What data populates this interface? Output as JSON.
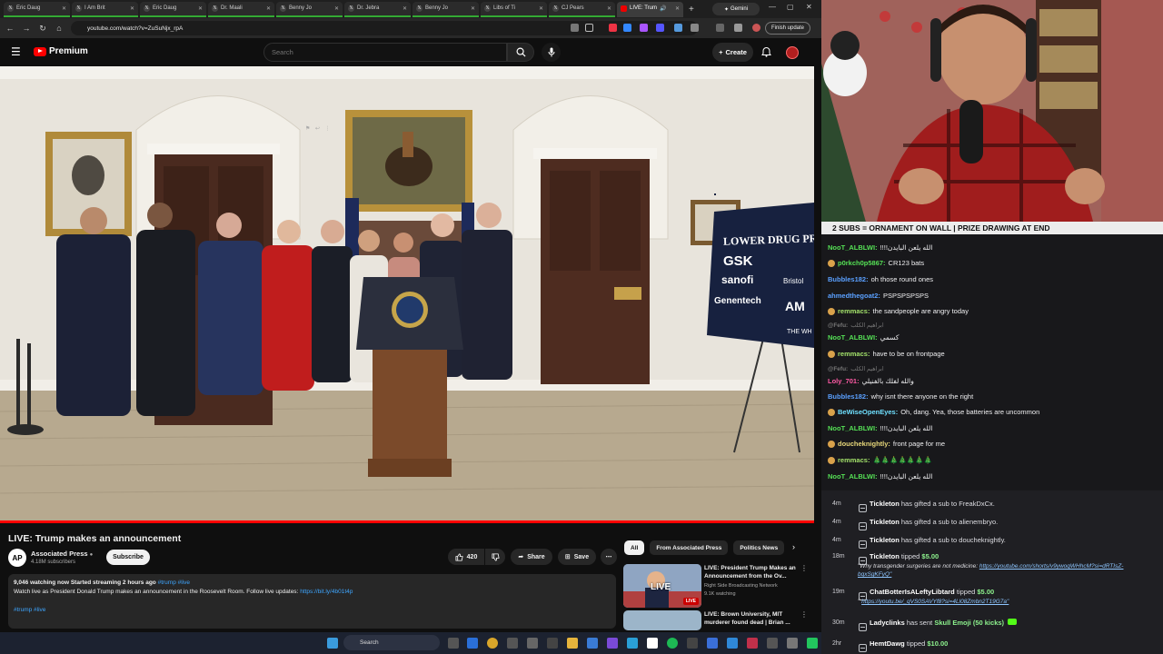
{
  "browser": {
    "tabs": [
      {
        "label": "Eric Daug",
        "icon": "x-icon"
      },
      {
        "label": "I Am Brit",
        "icon": "x-icon"
      },
      {
        "label": "Eric Daug",
        "icon": "x-icon"
      },
      {
        "label": "Dr. Maali",
        "icon": "x-icon"
      },
      {
        "label": "Benny Jo",
        "icon": "x-icon"
      },
      {
        "label": "Dr. Jebra",
        "icon": "x-icon"
      },
      {
        "label": "Benny Jo",
        "icon": "x-icon"
      },
      {
        "label": "Libs of Ti",
        "icon": "x-icon"
      },
      {
        "label": "CJ Pears",
        "icon": "x-icon"
      },
      {
        "label": "LIVE: Trum",
        "icon": "youtube-icon",
        "active": true
      }
    ],
    "gemini_label": "Gemini",
    "url": "youtube.com/watch?v=ZuSuNjx_rpA",
    "finish_update": "Finish update"
  },
  "youtube": {
    "logo_text": "Premium",
    "search_placeholder": "Search",
    "create_label": "Create",
    "video": {
      "title": "LIVE: Trump makes an announcement",
      "channel": "Associated Press",
      "channel_avatar": "AP",
      "subscribers": "4.18M subscribers",
      "subscribe_label": "Subscribe",
      "likes": "420",
      "share_label": "Share",
      "save_label": "Save",
      "desc_stats": "9,046 watching now  Started streaming 2 hours ago",
      "desc_tags": "#trump #live",
      "desc_text": "Watch live as President Donald Trump makes an announcement in the Roosevelt Room. Follow live updates:",
      "desc_link": "https://bit.ly/4b01t4p",
      "desc_hashtags": "#trump #live",
      "sign_brand": "LOWER DRUG PR",
      "sign_logos": [
        "GSK",
        "sanofi",
        "Bristol",
        "Genentech",
        "AM",
        "THE WH"
      ]
    },
    "chips": [
      "All",
      "From Associated Press",
      "Politics News"
    ],
    "recommendations": [
      {
        "title": "LIVE: President Trump Makes an Announcement from the Ov...",
        "channel": "Right Side Broadcasting Network",
        "meta": "9.1K watching",
        "badge": "LIVE"
      },
      {
        "title": "LIVE: Brown University, MIT murderer found dead | Brian ...",
        "channel": "",
        "meta": "",
        "badge": ""
      }
    ]
  },
  "taskbar": {
    "search_label": "Search"
  },
  "stream": {
    "banner": "2 SUBS = ORNAMENT ON WALL | PRIZE DRAWING AT END",
    "chat": [
      {
        "user": "NooT_ALBLWI:",
        "text": "!!!!الله يلعن البايدن",
        "color": "#55e055"
      },
      {
        "user": "p0rkch0p5867:",
        "text": "CR123 bats",
        "color": "#55e055",
        "badge": true
      },
      {
        "user": "Bubbles182:",
        "text": "oh those round ones",
        "color": "#5aa0ff"
      },
      {
        "user": "ahmedthegoat2:",
        "text": "PSPSPSPSPS",
        "color": "#5aa0ff"
      },
      {
        "user": "remmacs:",
        "text": "the sandpeople are angry today",
        "color": "#a2e06a",
        "badge": true
      },
      {
        "user": "@Fefu:",
        "text": "ابراهيم الكلب",
        "dim": true
      },
      {
        "user": "NooT_ALBLWI:",
        "text": "كسمي",
        "color": "#55e055"
      },
      {
        "user": "remmacs:",
        "text": "have to be on frontpage",
        "color": "#a2e06a",
        "badge": true
      },
      {
        "user": "@Fefu:",
        "text": "ابراهيم الكلب",
        "dim": true
      },
      {
        "user": "Loly_701:",
        "text": "والله لفلك بالفنيلي",
        "color": "#ff5aa5"
      },
      {
        "user": "Bubbles182:",
        "text": "why isnt there anyone on the right",
        "color": "#5aa0ff"
      },
      {
        "user": "BeWiseOpenEyes:",
        "text": "Oh, dang. Yea, those batteries are uncommon",
        "color": "#6fe0ff",
        "badge": true
      },
      {
        "user": "NooT_ALBLWI:",
        "text": "!!!!الله يلعن البايدن",
        "color": "#55e055"
      },
      {
        "user": "doucheknightly:",
        "text": "front page for me",
        "color": "#e8d87a",
        "badge": true
      },
      {
        "user": "remmacs:",
        "text": "🎄🎄🎄🎄🎄🎄🎄",
        "color": "#a2e06a",
        "badge": true
      },
      {
        "user": "NooT_ALBLWI:",
        "text": "!!!!الله يلعن البايدن",
        "color": "#55e055"
      }
    ],
    "events": [
      {
        "time": "4m",
        "user": "Tickleton",
        "text": "has gifted a sub to",
        "target": "FreakDxCx."
      },
      {
        "time": "4m",
        "user": "Tickleton",
        "text": "has gifted a sub to",
        "target": "alienembryo."
      },
      {
        "time": "4m",
        "user": "Tickleton",
        "text": "has gifted a sub to",
        "target": "doucheknightly."
      },
      {
        "time": "18m",
        "user": "Tickleton",
        "text": "tipped",
        "amount": "$5.00",
        "note": "\"Why transgender surgeries are not medicine:",
        "link": "https://youtube.com/shorts/v9ywoqWHhcM?si=dRTIsZ-bqxSgKFyQ\""
      },
      {
        "time": "19m",
        "user": "ChatBotterIsALeftyLibtard",
        "text": "tipped",
        "amount": "$5.00",
        "note": "\"",
        "link": "https://youtu.be/_qVS0SAVYf8?si=4Ll08Zmbn2T19G7a\""
      },
      {
        "time": "30m",
        "user": "Ladyclinks",
        "text": "has sent",
        "amount": "Skull Emoji (50 kicks)"
      },
      {
        "time": "2hr",
        "user": "HemtDawg",
        "text": "tipped",
        "amount": "$10.00"
      }
    ]
  }
}
